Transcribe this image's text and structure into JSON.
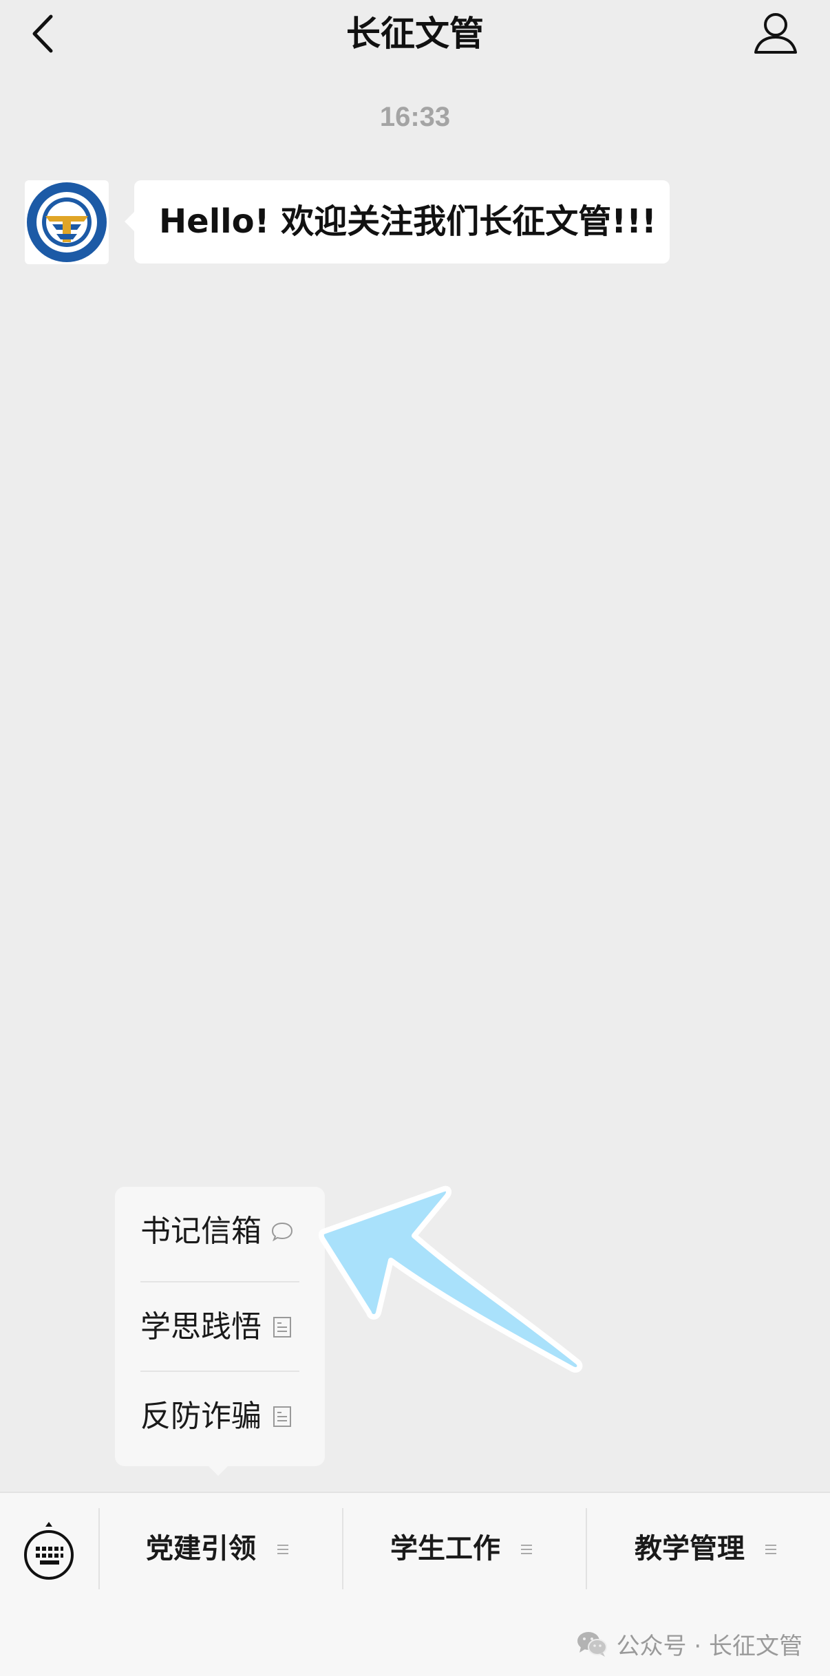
{
  "nav": {
    "title": "长征文管"
  },
  "chat": {
    "timestamp": "16:33",
    "message": "Hello! 欢迎关注我们长征文管!!!"
  },
  "submenu": {
    "items": [
      {
        "label": "书记信箱",
        "icon": "chat-bubble-icon"
      },
      {
        "label": "学思践悟",
        "icon": "document-icon"
      },
      {
        "label": "反防诈骗",
        "icon": "document-icon"
      }
    ]
  },
  "menu": {
    "tabs": [
      {
        "label": "党建引领",
        "icon": "menu-lines-icon"
      },
      {
        "label": "学生工作",
        "icon": "menu-lines-icon"
      },
      {
        "label": "教学管理",
        "icon": "menu-lines-icon"
      }
    ]
  },
  "watermark": {
    "text": "公众号 · 长征文管"
  },
  "colors": {
    "background": "#ededed",
    "bubble": "#ffffff",
    "arrow": "#a9e1fb",
    "logo_blue": "#1c5aa6",
    "logo_gold": "#e0a526"
  }
}
